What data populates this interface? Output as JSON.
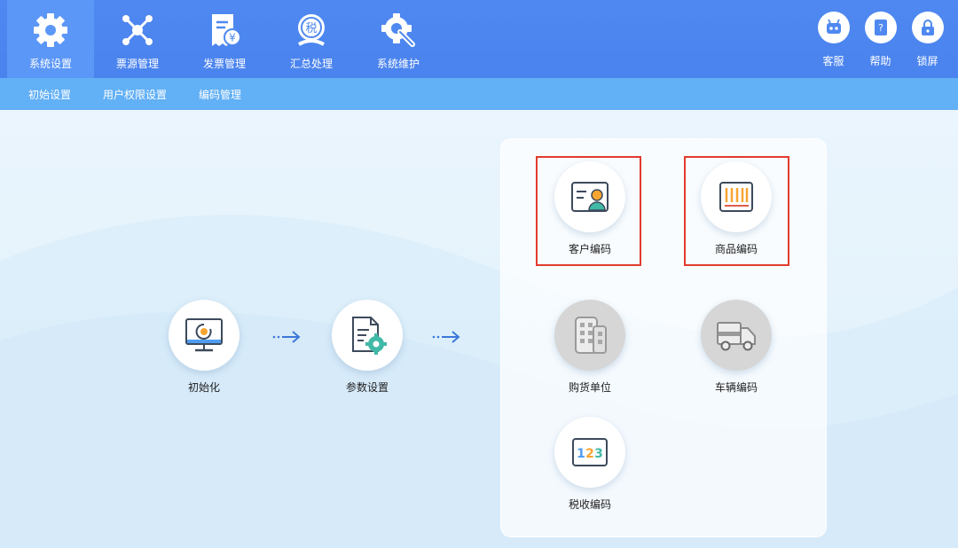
{
  "topnav": {
    "items": [
      {
        "label": "系统设置",
        "icon": "gear-icon"
      },
      {
        "label": "票源管理",
        "icon": "network-icon"
      },
      {
        "label": "发票管理",
        "icon": "invoice-icon"
      },
      {
        "label": "汇总处理",
        "icon": "tax-summary-icon"
      },
      {
        "label": "系统维护",
        "icon": "maintenance-icon"
      }
    ],
    "active": "系统设置"
  },
  "tools": [
    {
      "label": "客服",
      "icon": "robot-icon"
    },
    {
      "label": "帮助",
      "icon": "help-book-icon"
    },
    {
      "label": "锁屏",
      "icon": "lock-icon"
    }
  ],
  "subnav": [
    "初始设置",
    "用户权限设置",
    "编码管理"
  ],
  "flow": [
    {
      "label": "初始化",
      "icon": "monitor-icon"
    },
    {
      "label": "参数设置",
      "icon": "settings-document-icon"
    }
  ],
  "coding": [
    {
      "label": "客户编码",
      "icon": "customer-card-icon",
      "highlighted": true
    },
    {
      "label": "商品编码",
      "icon": "barcode-icon",
      "highlighted": true
    },
    {
      "label": "购货单位",
      "icon": "building-icon",
      "highlighted": false
    },
    {
      "label": "车辆编码",
      "icon": "truck-icon",
      "highlighted": false
    },
    {
      "label": "税收编码",
      "icon": "numbers-icon",
      "highlighted": false
    }
  ],
  "tax_glyph": "税",
  "yen_glyph": "¥",
  "numbers_glyph": [
    "1",
    "2",
    "3"
  ],
  "colors": {
    "topbar": "#4f88f0",
    "active_tab": "#5b97f7",
    "subbar": "#62b0f6",
    "highlight": "#e23b2e",
    "accent_orange": "#f7a531"
  }
}
